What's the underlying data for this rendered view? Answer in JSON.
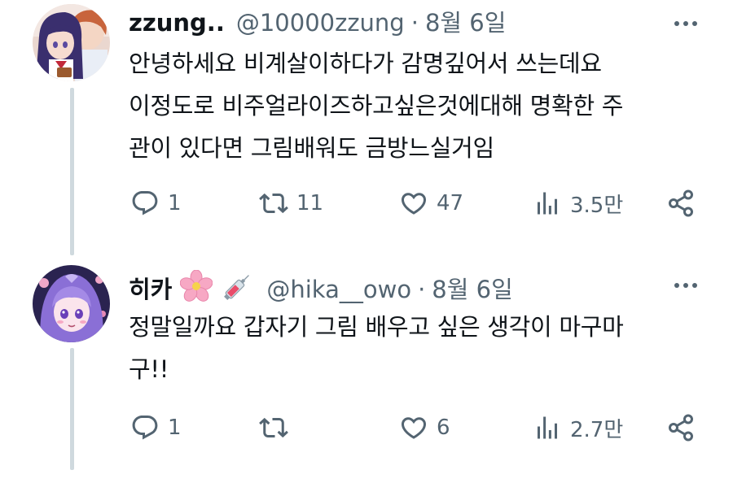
{
  "tweets": [
    {
      "display_name": "zzung..",
      "handle": "@10000zzung",
      "separator": "·",
      "date": "8월 6일",
      "avatar_icon": "anime-couple-avatar",
      "lines": [
        "안녕하세요 비계살이하다가 감명깊어서 쓰는데요",
        "이정도로 비주얼라이즈하고싶은것에대해 명확한 주",
        "관이 있다면 그림배워도 금방느실거임"
      ],
      "reply_count": "1",
      "retweet_count": "11",
      "like_count": "47",
      "views_count": "3.5만"
    },
    {
      "display_name": "히카",
      "emojis": [
        "cherry-blossom-icon",
        "syringe-icon"
      ],
      "handle": "@hika__owo",
      "separator": "·",
      "date": "8월 6일",
      "avatar_icon": "purple-hair-girl-avatar",
      "lines": [
        "정말일까요 갑자기 그림 배우고 싶은 생각이 마구마",
        "구!!"
      ],
      "reply_count": "1",
      "retweet_count": "",
      "like_count": "6",
      "views_count": "2.7만"
    }
  ],
  "colors": {
    "text_primary": "#0f1419",
    "text_secondary": "#536471",
    "thread_line": "#cfd9de",
    "blossom": "#f7a8c4"
  }
}
